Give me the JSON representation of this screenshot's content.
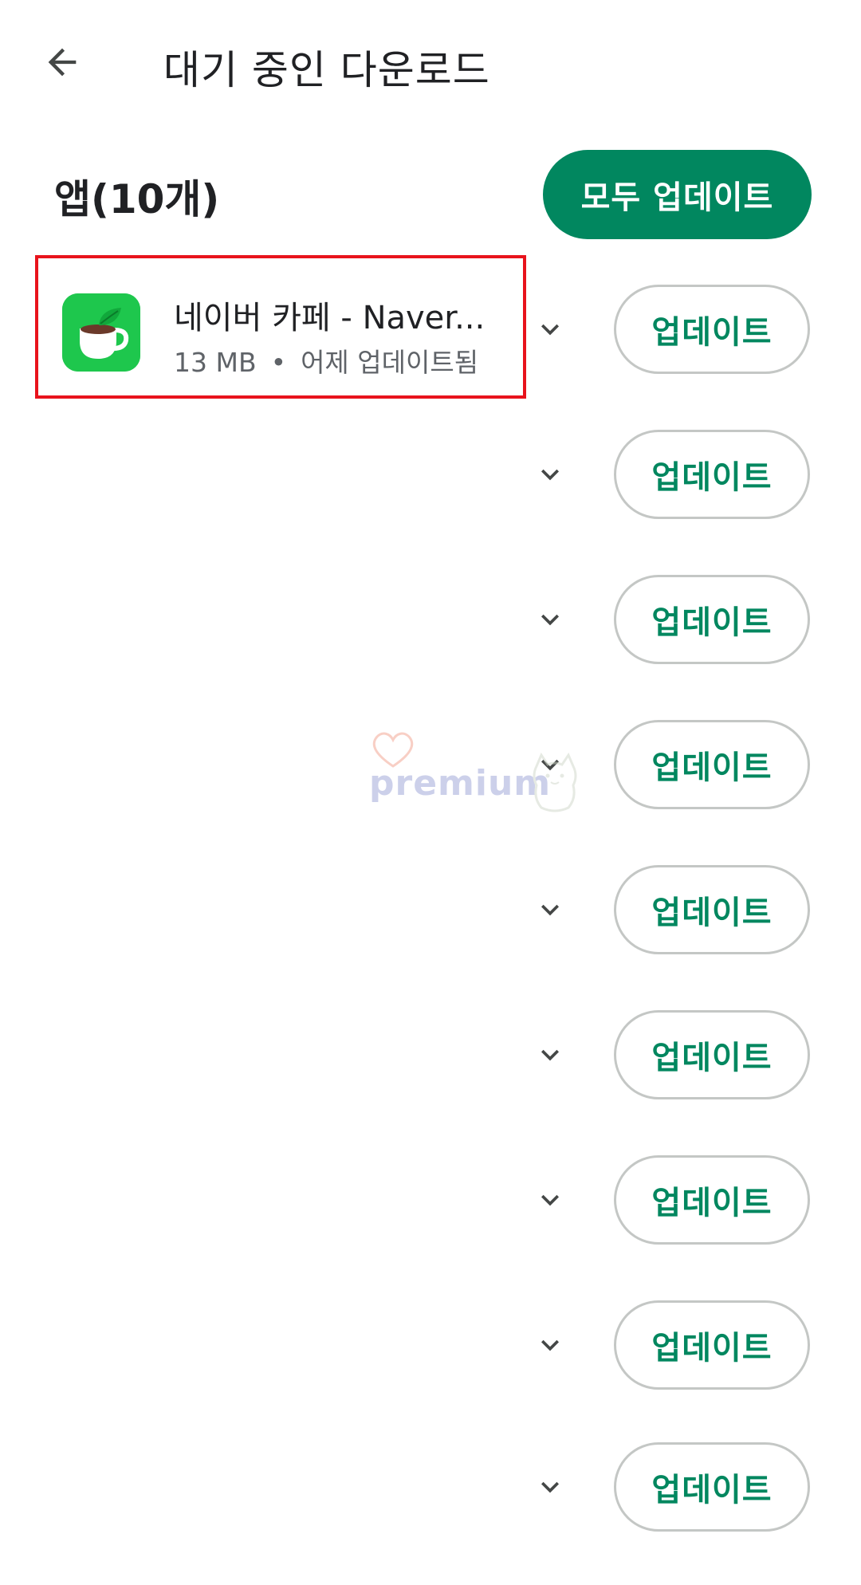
{
  "header": {
    "back_icon": "arrow-left-icon",
    "title": "대기 중인 다운로드"
  },
  "section": {
    "title": "앱(10개)",
    "update_all_label": "모두 업데이트"
  },
  "featured_app": {
    "name": "네이버 카페  - Naver...",
    "size": "13 MB",
    "separator": "•",
    "status": "어제 업데이트됨",
    "icon": "coffee-cup-leaf-icon",
    "icon_color": "#1ec74d"
  },
  "rows": [
    {
      "update_label": "업데이트",
      "expand_icon": "chevron-down-icon"
    },
    {
      "update_label": "업데이트",
      "expand_icon": "chevron-down-icon"
    },
    {
      "update_label": "업데이트",
      "expand_icon": "chevron-down-icon"
    },
    {
      "update_label": "업데이트",
      "expand_icon": "chevron-down-icon"
    },
    {
      "update_label": "업데이트",
      "expand_icon": "chevron-down-icon"
    },
    {
      "update_label": "업데이트",
      "expand_icon": "chevron-down-icon"
    },
    {
      "update_label": "업데이트",
      "expand_icon": "chevron-down-icon"
    },
    {
      "update_label": "업데이트",
      "expand_icon": "chevron-down-icon"
    },
    {
      "update_label": "업데이트",
      "expand_icon": "chevron-down-icon"
    }
  ],
  "watermark": {
    "text": "premium"
  },
  "colors": {
    "accent": "#01875f",
    "highlight_border": "#e8131c",
    "button_outline": "#c4c7c5"
  }
}
